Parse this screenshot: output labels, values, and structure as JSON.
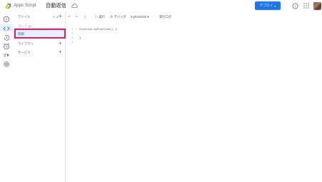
{
  "header": {
    "app_name": "Apps Script",
    "project_title": "自動返信",
    "deploy_label": "デプロイ",
    "deploy_caret": "▾",
    "accent_color": "#1a73e8"
  },
  "rail": {
    "icons": [
      "info-icon",
      "code-icon",
      "history-icon",
      "clock-icon",
      "executions-icon",
      "settings-icon"
    ]
  },
  "files_panel": {
    "files_label": "ファイル",
    "sort_label": "A↓Z",
    "code_label": "コード.gs",
    "selected_file": "無題",
    "libraries_label": "ライブラリ",
    "services_label": "サービス",
    "plus": "+"
  },
  "toolbar": {
    "undo": "↶",
    "redo": "↷",
    "save": "▢",
    "run": "▷ 実行",
    "debug": "⊕ デバッグ",
    "function_select": "myFunction ▾",
    "log": "実行ログ"
  },
  "editor": {
    "line_numbers": [
      "1",
      "2",
      "3",
      "4"
    ],
    "lines": [
      "function myFunction() {",
      "",
      "}",
      ""
    ]
  }
}
